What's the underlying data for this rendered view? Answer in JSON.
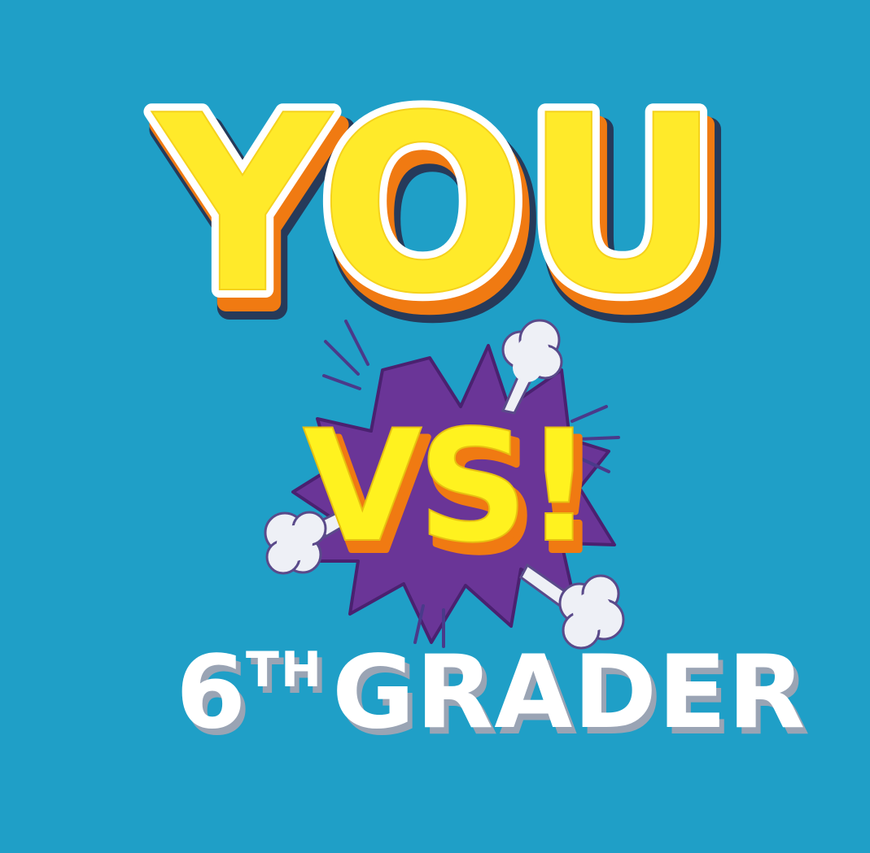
{
  "title_word": "YOU",
  "versus_word": "VS!",
  "grade_number": "6",
  "grade_suffix": "TH",
  "grade_label": "GRADER",
  "colors": {
    "background": "#1f9fc7",
    "title_fill": "#ffea2a",
    "title_extrude": "#f07a12",
    "title_outline": "#ffffff",
    "dark_outline": "#263a5a",
    "burst_fill": "#6a3597",
    "grader_fill": "#ffffff"
  },
  "icons": {
    "burst": "explosion-burst-icon",
    "smoke_puffs": "smoke-puff-icon",
    "speed_lines": "motion-lines-icon"
  }
}
